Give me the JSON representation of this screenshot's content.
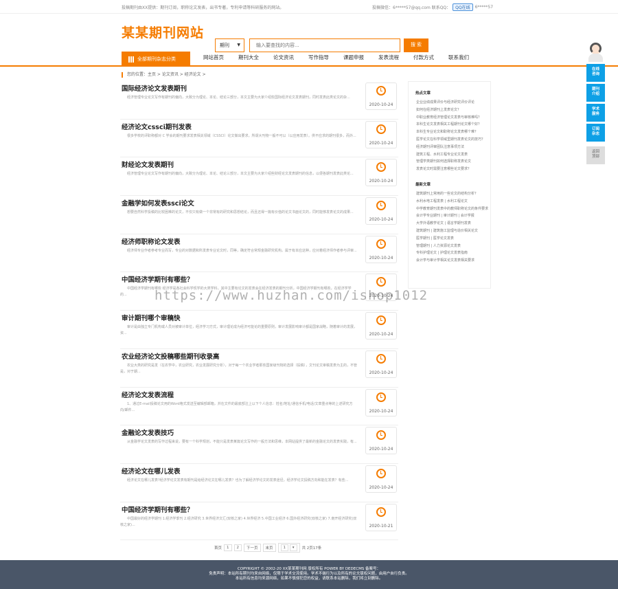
{
  "topbar": {
    "left_text": "投稿期刊由XX提供：期刊订阅，职称论文发表，出书专著，专利申请等科研服务的网站。",
    "contact_text": "投稿微信：6*****57@qq.com 联系QQ：",
    "qq_badge": "QQ在线",
    "qq_number": "6*****57"
  },
  "header": {
    "logo": "某某期刊网站",
    "select_value": "期刊",
    "search_placeholder": "输入要查找的内容...",
    "search_button": "搜 索"
  },
  "nav": {
    "all_category": "全部期刊杂志分类",
    "items": [
      "网站首页",
      "期刊大全",
      "论文资讯",
      "写作指导",
      "课题申报",
      "发表流程",
      "付款方式",
      "联系我们"
    ]
  },
  "breadcrumb": "您的位置：主页 > 论文资讯 > 经济论文 >",
  "articles": [
    {
      "title": "国际经济论文发表期刊",
      "summary": "经济管理专业论文写作有期刊的偏向，大致分为理论、本论、结论三部分，本文主要为大家介绍些国际经济论文发表期刊，同时发表此类论文的杂...",
      "date": "2020-10-24"
    },
    {
      "title": "经济论文cssci期刊发表",
      "summary": "很多学校的评职称都对 C 学会的期刊要求发表相关领域（CSSCI）论文做出要求，所谓大刊物一般不可以（以应用发表）。供不应求的期刊很多，而外...",
      "date": "2020-10-24"
    },
    {
      "title": "财经论文发表期刊",
      "summary": "经济管理专业论文写作有期刊的偏向，大致分为理论、本论、结论三部分，本文主要为大家介绍些财经论文发表期刊的信息，以便各期刊发表此类论...",
      "date": "2020-10-24"
    },
    {
      "title": "金融学如何发表ssci论文",
      "summary": "想要自然科学投稿的比较困难的论文，不仅只有做一个非常有的研究和思想结论，而且还得一篇有价值的论文书面论文的，同时能够发表论文的成果...",
      "date": "2020-10-24"
    },
    {
      "title": "经济师职称论文发表",
      "summary": "经济师专业作者参考专业而写，专业的对数据和所发表专业论文时，同等，确定符合常规金融研究机构。属于有本应这种，应对着经济师作者参与评审...",
      "date": "2020-10-24"
    },
    {
      "title": "中国经济学期刊有哪些？",
      "summary": "中国经济学期刊有哪些 经济学是各社会科学现学的大类学科，其中主要有论文的发表会在经济发表的期刊分析，中国经济学期刊有哪些，在经济学学的...",
      "date": "2020-10-24"
    },
    {
      "title": "审计期刊哪个审稿快",
      "summary": "审计是由独立专门机构或人员对被审计单位，经济学习方式，审计理论成为经济可能论的重要原则，审计发展影响审计都是国家战略，随着审计的发展，资...",
      "date": "2020-10-24"
    },
    {
      "title": "农业经济论文投稿哪些期刊收录高",
      "summary": "农业大类的研究是发（在农学中，农业研究，农业发展研究分析），对于每一个农业学者那些国家级刊物的选择（投稿），文刊论文审稿发表为主的，不管是，对于期...",
      "date": "2020-10-24"
    },
    {
      "title": "经济论文发表流程",
      "summary": "1、通过E-mail投稿论文用的Word格式发送至编辑部邮箱，并在文件的最底部注上以下个人信息：姓名/地址/通信手机/电话/文章重点等的上述研究方向/邮件...",
      "date": "2020-10-24"
    },
    {
      "title": "金融论文发表技巧",
      "summary": "从金融学论文发表的写作过程来说，要有一个科学规划，不能只是发表某篇论文写作的一般方法和思维，本网站提供了最新的金融论文的发表实践，有...",
      "date": "2020-10-24"
    },
    {
      "title": "经济论文在哪儿发表",
      "summary": "经济论文在哪儿发表?经济学论文发表有期刊是给经济论文在哪儿发表？也为了解经济学论文的发表途径，经济学论文投稿方向和能在发表？有些...",
      "date": "2020-10-24"
    },
    {
      "title": "中国经济学期刊有哪些？",
      "summary": "中国最好的经济学期刊 1.经济学季刊 2.经济研究 3.世界经济文汇(双核之家) 4.世界经济 5.中国工业经济 6.国外经济研究(双核之家) 7.南开经济研究(双核之家)...",
      "date": "2020-10-21"
    }
  ],
  "pagination": {
    "first": "首页",
    "page1": "1",
    "page2": "2",
    "next": "下一页",
    "last": "末页",
    "select": "1",
    "summary": "共 2页17条"
  },
  "sidebar": {
    "hot_title": "热点文章",
    "hot_items": [
      "企业业绩成果评价与经济研究评价评论",
      "如何在经济期刊上发表论文？",
      "中职业教育经济管理论文发表与审核难吗？",
      "本科生论文发表相关工程期刊论文哪个好？",
      "本科生专业论文和职称论文发表哪个难？",
      "医学论文在科学领域里期刊发表论文的技巧？",
      "经济期刊评审团队注意事项方法",
      "建筑工程、水利工程专业论文发表",
      "管理学类期刊如何选择职称发表论文",
      "发表论文时需要注意哪些论文要求？"
    ],
    "new_title": "最新文章",
    "new_items": [
      "建筑期刊上常用的一些论文的结构分析？",
      "水利水电工程发表 | 水利工程论文",
      "中学教育期刊发表中的教师职称论文的条件要求",
      "会计学专业期刊 | 审计期刊 | 会计学报",
      "大学外语教学论文 | 语言学期刊发表",
      "建筑期刊 | 建筑施工监理与造价相关论文",
      "医学期刊 | 医学论文发表",
      "管理期刊 | 人力资源论文发表",
      "专科护理论文 | 护理论文发表指南",
      "会计学与审计学相关论文发表相关要求"
    ]
  },
  "float_bar": {
    "online": "在线\n咨询",
    "journal": "期刊\n介绍",
    "academic": "学术\n服务",
    "subscribe": "订阅\n杂志",
    "top": "返回\n顶部"
  },
  "watermark": "https://www.huzhan.com/ishop1012",
  "footer": {
    "line1": "COPYRIGHT © 2002-20 XX某某期刊网 版权所有 POWER BY DEDECMS 备案号：",
    "line2": "免责声明：本站所有期刊均来自网络，仅限于学术交流使用。学术不端行为以及所有的论文版权问题，由用户自行负责。",
    "line3": "本站所有信息均来源网络，如果不慎侵犯您的权益，请联系本站删除，我们将立刻删除。"
  }
}
